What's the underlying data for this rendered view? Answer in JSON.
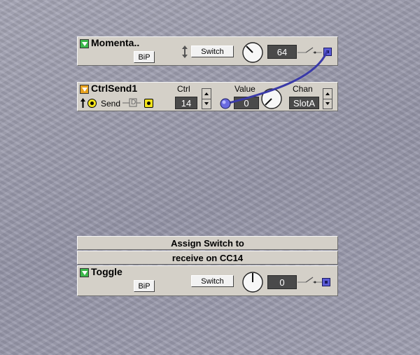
{
  "momentary": {
    "title": "Momenta..",
    "bip_label": "BiP",
    "switch_label": "Switch",
    "value": "64"
  },
  "ctrlsend": {
    "title": "CtrlSend1",
    "send_label": "Send",
    "ctrl_header": "Ctrl",
    "ctrl_value": "14",
    "value_header": "Value",
    "value_value": "0",
    "chan_header": "Chan",
    "chan_value": "SlotA",
    "d_label": "D"
  },
  "note": {
    "line1": "Assign Switch to",
    "line2": "receive on CC14"
  },
  "toggle": {
    "title": "Toggle",
    "bip_label": "BiP",
    "switch_label": "Switch",
    "value": "0"
  },
  "colors": {
    "cable": "#3a3aa8",
    "port_blue": "#5b5bd6",
    "port_yellow": "#f3e31b",
    "collapse_green": "#3bb84a",
    "collapse_orange": "#e8a21e"
  },
  "icons": [
    "collapse-arrow-icon",
    "knob-icon",
    "updown-arrow-icon",
    "output-port-icon",
    "input-port-icon",
    "spinner-icon",
    "switch-lever-icon"
  ]
}
